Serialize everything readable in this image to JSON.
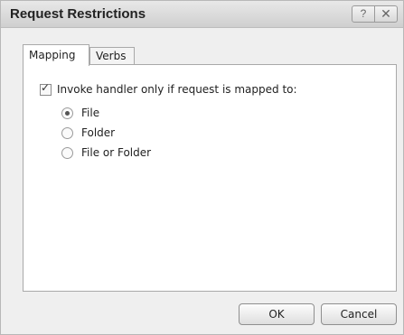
{
  "window": {
    "title": "Request Restrictions",
    "help_glyph": "?",
    "close_glyph": "✕"
  },
  "tabs": [
    {
      "label": "Mapping",
      "active": true
    },
    {
      "label": "Verbs",
      "active": false
    }
  ],
  "mapping": {
    "checkbox_label": "Invoke handler only if request is mapped to:",
    "checkbox_checked": true,
    "options": [
      {
        "label": "File",
        "selected": true
      },
      {
        "label": "Folder",
        "selected": false
      },
      {
        "label": "File or Folder",
        "selected": false
      }
    ]
  },
  "buttons": {
    "ok": "OK",
    "cancel": "Cancel"
  }
}
